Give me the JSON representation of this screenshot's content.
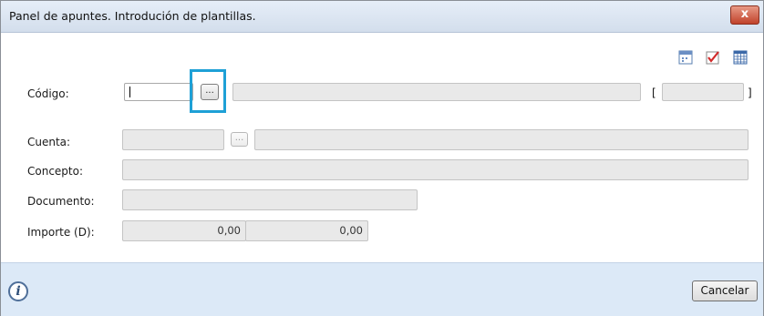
{
  "window": {
    "title": "Panel de apuntes. Introdución de plantillas.",
    "close_label": "x"
  },
  "toolbar": {
    "icons": [
      "calendar-icon",
      "checklist-icon",
      "grid-icon"
    ]
  },
  "form": {
    "codigo": {
      "label": "Código:",
      "value": "",
      "lookup_label": "...",
      "bracket_open": "[",
      "bracket_close": "]"
    },
    "cuenta": {
      "label": "Cuenta:",
      "value": "",
      "lookup_label": "..."
    },
    "concepto": {
      "label": "Concepto:",
      "value": ""
    },
    "documento": {
      "label": "Documento:",
      "value": ""
    },
    "importe": {
      "label": "Importe (D):",
      "debe": "0,00",
      "haber": "0,00"
    }
  },
  "footer": {
    "info_glyph": "i",
    "cancel_label": "Cancelar"
  },
  "colors": {
    "highlight": "#1ea0d6",
    "footer_bg": "#dce9f7",
    "titlebar_bg": "#d3deec"
  }
}
